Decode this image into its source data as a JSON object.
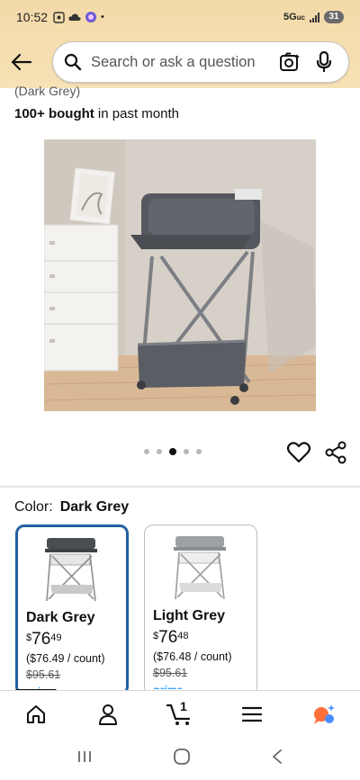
{
  "status_bar": {
    "time": "10:52",
    "network": "5G",
    "network_suffix": "uc",
    "battery": "31"
  },
  "search": {
    "placeholder": "Search or ask a question"
  },
  "product": {
    "variant_caption": "(Dark Grey)",
    "bought_bold": "100+ bought",
    "bought_rest": " in past month",
    "image_count": 5,
    "active_image_index": 2
  },
  "color_selector": {
    "label": "Color:",
    "selected": "Dark Grey",
    "options": [
      {
        "name": "Dark Grey",
        "price_symbol": "$",
        "price_whole": "76",
        "price_fraction": "49",
        "unit_price": "($76.49 / count)",
        "list_price": "$95.61",
        "badge": "prime",
        "selected": true
      },
      {
        "name": "Light Grey",
        "price_symbol": "$",
        "price_whole": "76",
        "price_fraction": "48",
        "unit_price": "($76.48 / count)",
        "list_price": "$95.61",
        "badge": "prime",
        "selected": false
      }
    ]
  },
  "bottom_nav": {
    "cart_count": "1",
    "items": [
      "home-icon",
      "account-icon",
      "cart-icon",
      "menu-icon",
      "rufus-icon"
    ]
  },
  "colors": {
    "header_bg": "#f3d9a8",
    "selected_border": "#2162a1",
    "prime_blue": "#1a98ff",
    "assistant_orange": "#ff6f3c",
    "assistant_blue": "#4a8cff"
  }
}
